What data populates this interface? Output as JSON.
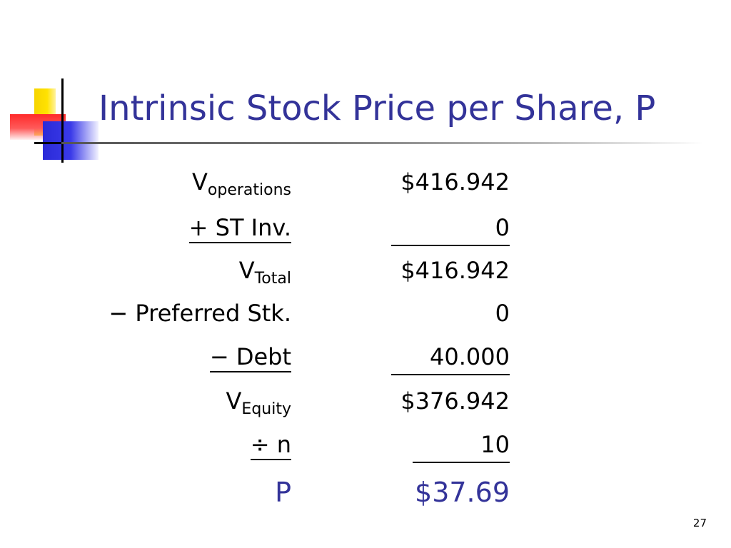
{
  "slide": {
    "title": "Intrinsic Stock Price per Share, P",
    "page_number": "27"
  },
  "rows": [
    {
      "label_main": "V",
      "label_sub": "operations",
      "value": "$416.942"
    },
    {
      "label_main": "+ ST Inv.",
      "value": "0"
    },
    {
      "label_main": "V",
      "label_sub": "Total",
      "value": "$416.942"
    },
    {
      "label_main": "− Preferred Stk.",
      "value": "0"
    },
    {
      "label_main": "− Debt",
      "value": "40.000"
    },
    {
      "label_main": "V",
      "label_sub": "Equity",
      "value": "$376.942"
    },
    {
      "label_main": "÷ n",
      "value": "10"
    },
    {
      "label_main": "P",
      "value": "$37.69"
    }
  ],
  "colors": {
    "title": "#333399",
    "result": "#333399"
  }
}
